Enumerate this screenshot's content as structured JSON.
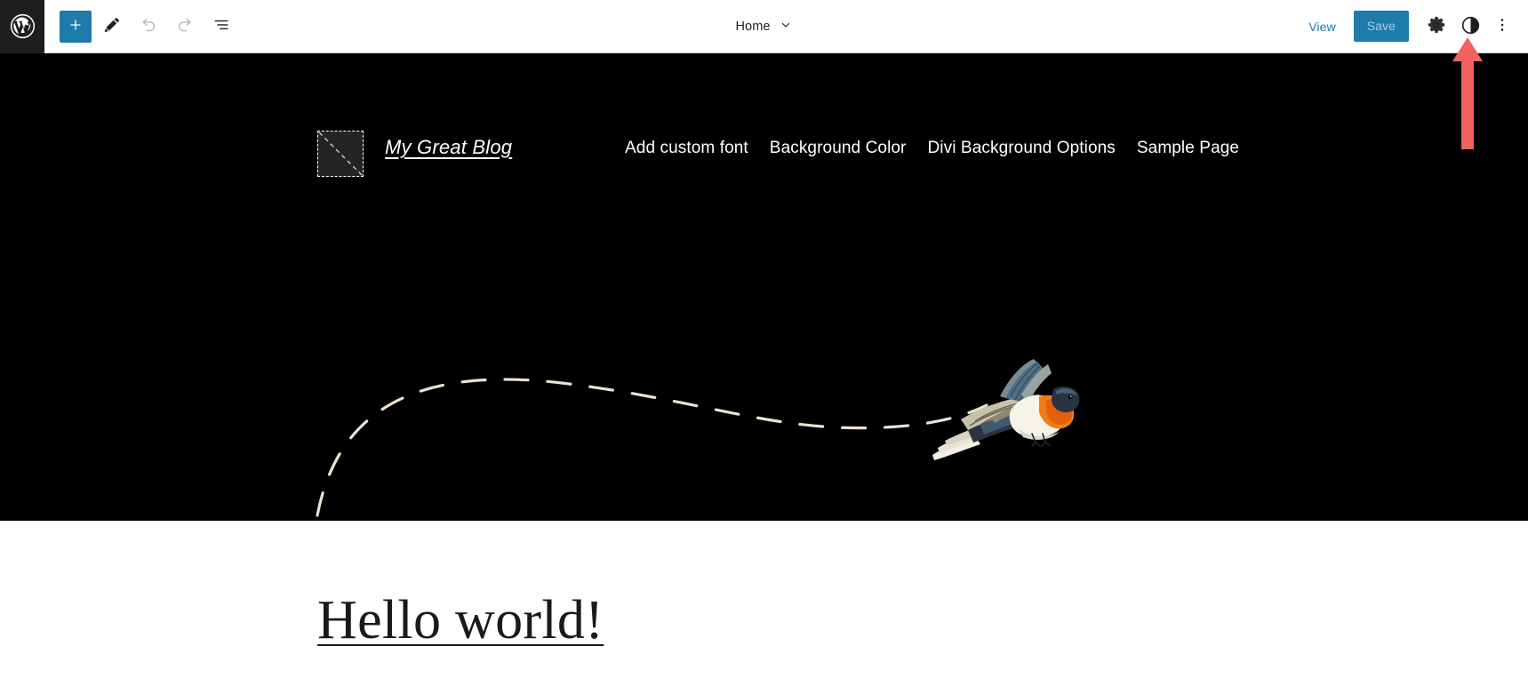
{
  "editor_toolbar": {
    "wp_logo": {
      "icon": "wordpress-logo-icon",
      "label": "WordPress"
    },
    "add_block": {
      "icon": "plus-icon",
      "label": "Toggle block inserter"
    },
    "tools": {
      "icon": "pencil-icon",
      "label": "Tools"
    },
    "undo": {
      "icon": "undo-icon",
      "label": "Undo"
    },
    "redo": {
      "icon": "redo-icon",
      "label": "Redo"
    },
    "list_view": {
      "icon": "list-view-icon",
      "label": "Document Overview"
    },
    "document_title": "Home",
    "document_title_chevron": "chevron-down-icon",
    "view_label": "View",
    "save_label": "Save",
    "settings": {
      "icon": "gear-icon",
      "label": "Settings"
    },
    "styles": {
      "icon": "contrast-circle-icon",
      "label": "Styles"
    },
    "options": {
      "icon": "three-dots-vertical-icon",
      "label": "Options"
    }
  },
  "site_preview": {
    "site_title": "My Great Blog",
    "logo_placeholder_name": "site-logo-placeholder",
    "nav_items": [
      {
        "label": "Add custom font"
      },
      {
        "label": "Background Color"
      },
      {
        "label": "Divi Background Options"
      },
      {
        "label": "Sample Page"
      }
    ],
    "hero_background_color": "#000000",
    "post_title": "Hello world!",
    "decoration": {
      "bird_name": "flying-bird-illustration",
      "dashed_path_name": "dashed-flight-path",
      "dashed_path_color": "#ece2d0"
    }
  },
  "annotation": {
    "arrow_name": "red-arrow-pointing-at-styles-button",
    "arrow_color": "#f2635f",
    "points_at": "styles-button"
  },
  "colors": {
    "accent_blue": "#1d7cab",
    "toolbar_background": "#ffffff",
    "logo_block_background": "#1e1e1e",
    "hero_background": "#000000"
  }
}
